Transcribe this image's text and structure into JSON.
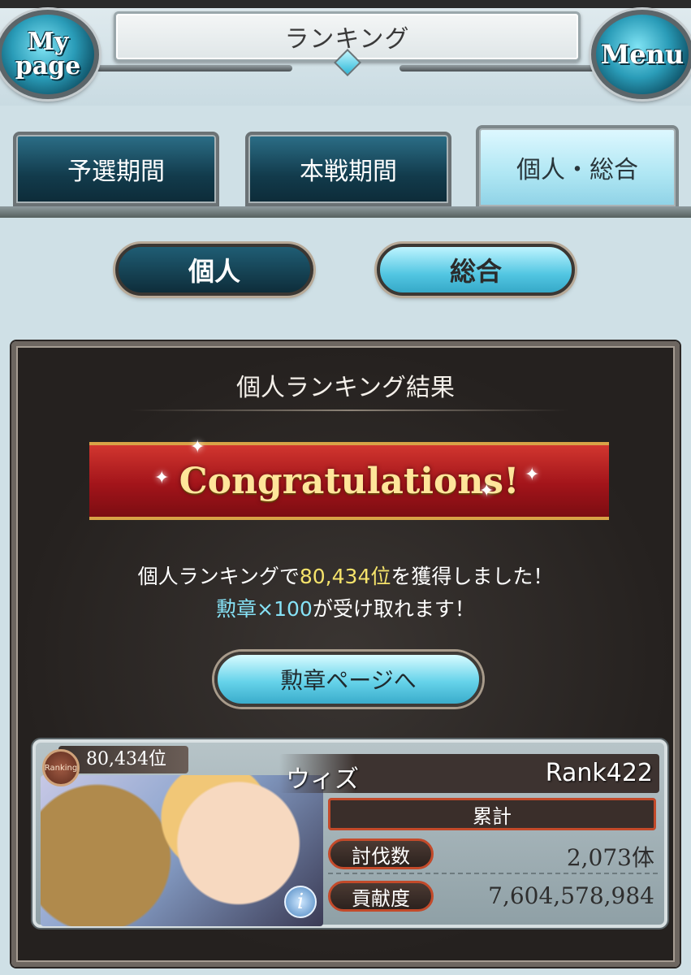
{
  "header": {
    "title": "ランキング",
    "mypage_line1": "My",
    "mypage_line2": "page",
    "menu_label": "Menu"
  },
  "tabs": [
    {
      "label": "予選期間",
      "active": false
    },
    {
      "label": "本戦期間",
      "active": false
    },
    {
      "label": "個人・総合",
      "active": true
    }
  ],
  "sub_tabs": {
    "kojin": "個人",
    "sougou": "総合"
  },
  "result": {
    "panel_title": "個人ランキング結果",
    "banner": "Congratulations!",
    "line1_prefix": "個人ランキングで",
    "line1_rank": "80,434位",
    "line1_suffix": "を獲得しました！",
    "line2_reward": "勲章×100",
    "line2_suffix": "が受け取れます！",
    "medal_button": "勲章ページへ"
  },
  "card": {
    "badge": "Ranking",
    "position": "80,434位",
    "player_name": "ウィズ",
    "player_rank": "Rank422",
    "total_label": "累計",
    "kills_label": "討伐数",
    "kills_value": "2,073体",
    "contrib_label": "貢献度",
    "contrib_value": "7,604,578,984",
    "info_icon": "i"
  },
  "colors": {
    "highlight_rank": "#f5e36b",
    "highlight_reward": "#86e2f6",
    "ribbon": "#a2141a"
  }
}
